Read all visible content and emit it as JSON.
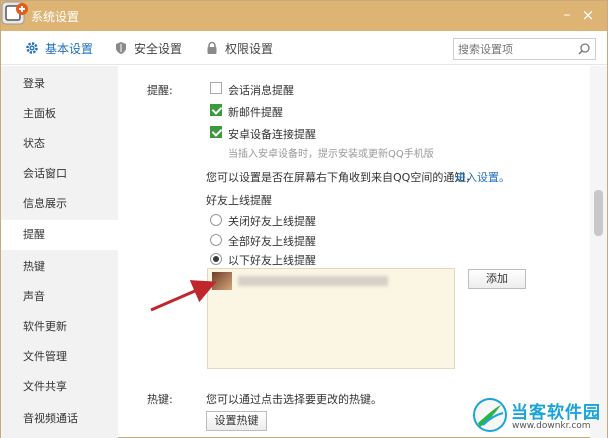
{
  "window": {
    "title": "系统设置",
    "minimize": "–",
    "close": "×"
  },
  "tabs": [
    {
      "label": "基本设置",
      "icon": "gear-icon",
      "active": true
    },
    {
      "label": "安全设置",
      "icon": "shield-icon",
      "active": false
    },
    {
      "label": "权限设置",
      "icon": "lock-icon",
      "active": false
    }
  ],
  "search": {
    "placeholder": "搜索设置项",
    "icon": "search-icon"
  },
  "sidebar": {
    "items": [
      {
        "label": "登录"
      },
      {
        "label": "主面板"
      },
      {
        "label": "状态"
      },
      {
        "label": "会话窗口"
      },
      {
        "label": "信息展示"
      },
      {
        "label": "提醒",
        "active": true
      },
      {
        "label": "热键"
      },
      {
        "label": "声音"
      },
      {
        "label": "软件更新"
      },
      {
        "label": "文件管理"
      },
      {
        "label": "文件共享"
      },
      {
        "label": "音视频通话"
      }
    ]
  },
  "reminder": {
    "section_label": "提醒:",
    "options": [
      {
        "label": "会话消息提醒",
        "checked": false
      },
      {
        "label": "新邮件提醒",
        "checked": true
      },
      {
        "label": "安卓设备连接提醒",
        "checked": true
      }
    ],
    "android_hint": "当插入安卓设备时，提示安装或更新QQ手机版",
    "notice_text": "您可以设置是否在屏幕右下角收到来自QQ空间的通知，",
    "notice_link": "进入设置。",
    "friend_online": {
      "title": "好友上线提醒",
      "options": [
        {
          "label": "关闭好友上线提醒",
          "checked": false
        },
        {
          "label": "全部好友上线提醒",
          "checked": false
        },
        {
          "label": "以下好友上线提醒",
          "checked": true
        }
      ],
      "add_button": "添加"
    }
  },
  "hotkey": {
    "section_label": "热键:",
    "desc": "您可以通过点击选择要更改的热键。",
    "button": "设置热键"
  },
  "watermark": {
    "title": "当客软件园",
    "url": "www.downkr.com"
  },
  "colors": {
    "titlebar": "#ddb474",
    "accent": "#1e6fbf",
    "check": "#3c9a3c",
    "arrow": "#c0272d",
    "friend_box": "#fbf5e4"
  }
}
